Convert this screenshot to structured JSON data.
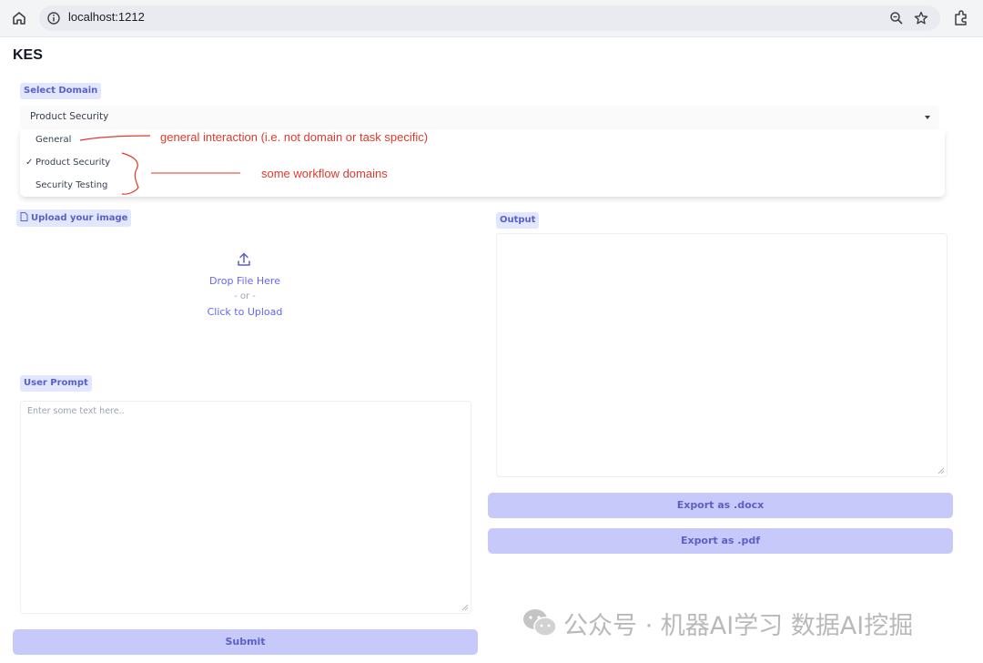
{
  "browser": {
    "url": "localhost:1212",
    "icons": [
      "home-icon",
      "info-icon",
      "zoom-icon",
      "star-icon",
      "extensions-icon"
    ]
  },
  "app": {
    "title": "KES"
  },
  "domain": {
    "label": "Select Domain",
    "selected": "Product Security",
    "options": [
      {
        "label": "General",
        "checked": false
      },
      {
        "label": "Product Security",
        "checked": true
      },
      {
        "label": "Security Testing",
        "checked": false
      }
    ],
    "check_mark": "✓"
  },
  "annotations": {
    "general_note": "general interaction (i.e. not domain or task specific)",
    "workflow_note": "some workflow domains",
    "color": "#e0392b"
  },
  "upload": {
    "label": "Upload your image",
    "drop_text": "Drop File Here",
    "or_text": "- or -",
    "click_text": "Click to Upload"
  },
  "prompt": {
    "label": "User Prompt",
    "placeholder": "Enter some text here..",
    "submit_label": "Submit"
  },
  "output": {
    "label": "Output",
    "export_docx_label": "Export as .docx",
    "export_pdf_label": "Export as .pdf"
  },
  "watermark": {
    "text": "公众号 · 机器AI学习 数据AI挖掘"
  },
  "colors": {
    "accent": "#5b5fc7",
    "button_bg": "#c7c9fb",
    "chip_bg": "#e0e7ff"
  }
}
